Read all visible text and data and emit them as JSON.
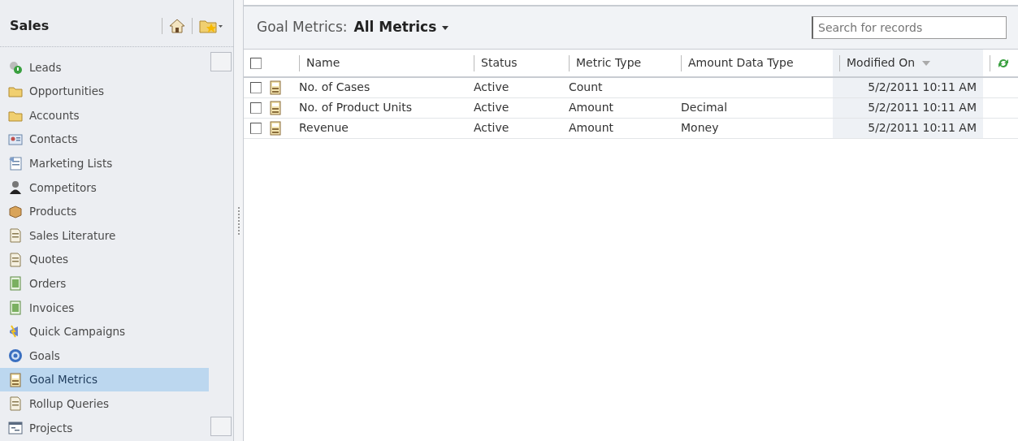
{
  "sidebar": {
    "title": "Sales",
    "items": [
      {
        "label": "Leads",
        "selected": false
      },
      {
        "label": "Opportunities",
        "selected": false
      },
      {
        "label": "Accounts",
        "selected": false
      },
      {
        "label": "Contacts",
        "selected": false
      },
      {
        "label": "Marketing Lists",
        "selected": false
      },
      {
        "label": "Competitors",
        "selected": false
      },
      {
        "label": "Products",
        "selected": false
      },
      {
        "label": "Sales Literature",
        "selected": false
      },
      {
        "label": "Quotes",
        "selected": false
      },
      {
        "label": "Orders",
        "selected": false
      },
      {
        "label": "Invoices",
        "selected": false
      },
      {
        "label": "Quick Campaigns",
        "selected": false
      },
      {
        "label": "Goals",
        "selected": false
      },
      {
        "label": "Goal Metrics",
        "selected": true
      },
      {
        "label": "Rollup Queries",
        "selected": false
      },
      {
        "label": "Projects",
        "selected": false
      }
    ]
  },
  "view": {
    "entity": "Goal Metrics:",
    "name": "All Metrics"
  },
  "search": {
    "placeholder": "Search for records"
  },
  "table": {
    "select_all": {
      "checked": false
    },
    "columns": [
      {
        "label": "Name",
        "sorted": false
      },
      {
        "label": "Status",
        "sorted": false
      },
      {
        "label": "Metric Type",
        "sorted": false
      },
      {
        "label": "Amount Data Type",
        "sorted": false
      },
      {
        "label": "Modified On",
        "sorted": true
      }
    ],
    "rows": [
      {
        "checked": false,
        "cells": [
          "No. of Cases",
          "Active",
          "Count",
          "",
          "5/2/2011 10:11 AM"
        ]
      },
      {
        "checked": false,
        "cells": [
          "No. of Product Units",
          "Active",
          "Amount",
          "Decimal",
          "5/2/2011 10:11 AM"
        ]
      },
      {
        "checked": false,
        "cells": [
          "Revenue",
          "Active",
          "Amount",
          "Money",
          "5/2/2011 10:11 AM"
        ]
      }
    ]
  }
}
